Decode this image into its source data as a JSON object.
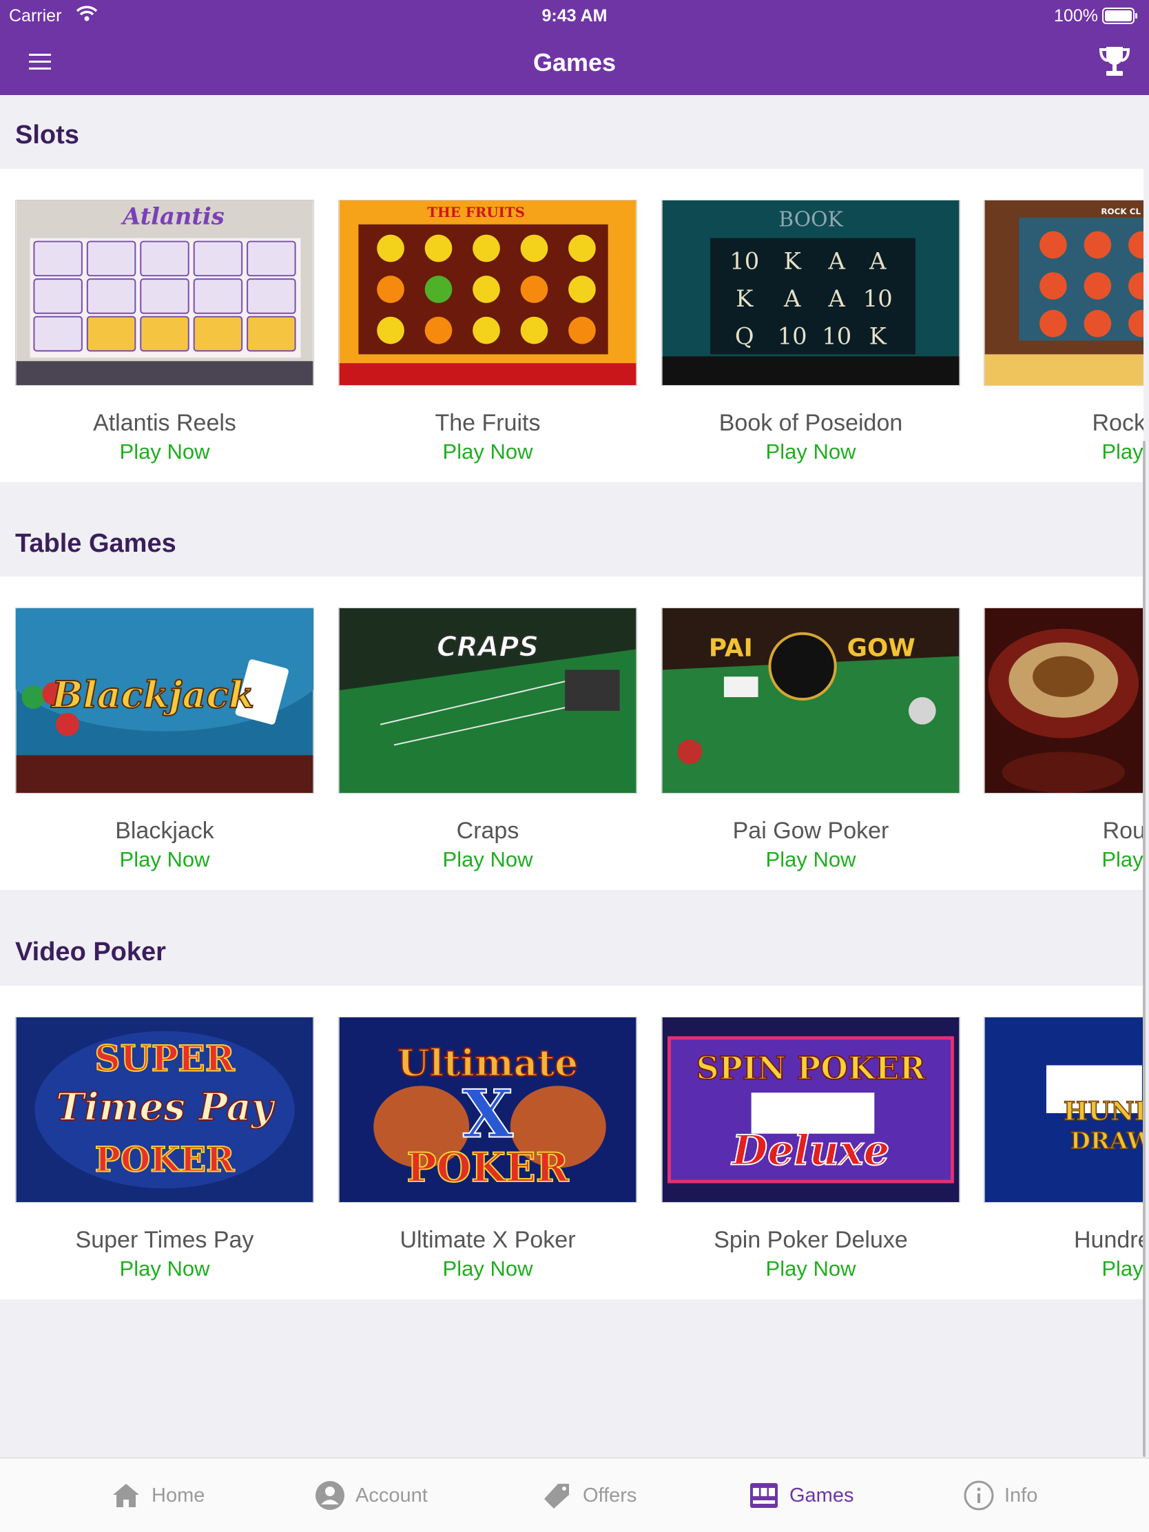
{
  "status_bar": {
    "carrier": "Carrier",
    "time": "9:43 AM",
    "battery": "100%"
  },
  "nav": {
    "title": "Games",
    "menu_icon": "hamburger-menu-icon",
    "trophy_icon": "trophy-icon"
  },
  "sections": [
    {
      "title": "Slots",
      "games": [
        {
          "name": "Atlantis Reels",
          "action": "Play Now"
        },
        {
          "name": "The Fruits",
          "action": "Play Now"
        },
        {
          "name": "Book of Poseidon",
          "action": "Play Now"
        },
        {
          "name": "Rock Cl",
          "action": "Play N"
        }
      ]
    },
    {
      "title": "Table Games",
      "games": [
        {
          "name": "Blackjack",
          "action": "Play Now"
        },
        {
          "name": "Craps",
          "action": "Play Now"
        },
        {
          "name": "Pai Gow Poker",
          "action": "Play Now"
        },
        {
          "name": "Roule",
          "action": "Play N"
        }
      ]
    },
    {
      "title": "Video Poker",
      "games": [
        {
          "name": "Super Times Pay",
          "action": "Play Now"
        },
        {
          "name": "Ultimate X Poker",
          "action": "Play Now"
        },
        {
          "name": "Spin Poker Deluxe",
          "action": "Play Now"
        },
        {
          "name": "Hundred Di",
          "action": "Play N"
        }
      ]
    }
  ],
  "thumb_text": {
    "atlantis": "Atlantis",
    "fruits": "THE FRUITS",
    "poseidon": "BOOK",
    "rock": "ROCK CL",
    "blackjack": "Blackjack",
    "craps": "CRAPS",
    "paigow_left": "PAI",
    "paigow_right": "GOW",
    "super_top": "SUPER",
    "super_mid": "Times Pay",
    "super_bottom": "POKER",
    "ultimate_top": "Ultimate",
    "ultimate_mid": "X",
    "ultimate_bottom": "POKER",
    "spin_top": "SPIN POKER",
    "spin_bottom": "Deluxe",
    "hundred_top": "HUNDRE",
    "hundred_bottom": "DRAW P"
  },
  "tabs": [
    {
      "label": "Home",
      "icon": "home-icon",
      "active": false
    },
    {
      "label": "Account",
      "icon": "account-icon",
      "active": false
    },
    {
      "label": "Offers",
      "icon": "tag-icon",
      "active": false
    },
    {
      "label": "Games",
      "icon": "slot-machine-icon",
      "active": true
    },
    {
      "label": "Info",
      "icon": "info-icon",
      "active": false
    }
  ],
  "colors": {
    "brand": "#6f35a5",
    "play": "#1fae1f",
    "section_title": "#3b1e5c",
    "background": "#efeff4"
  }
}
